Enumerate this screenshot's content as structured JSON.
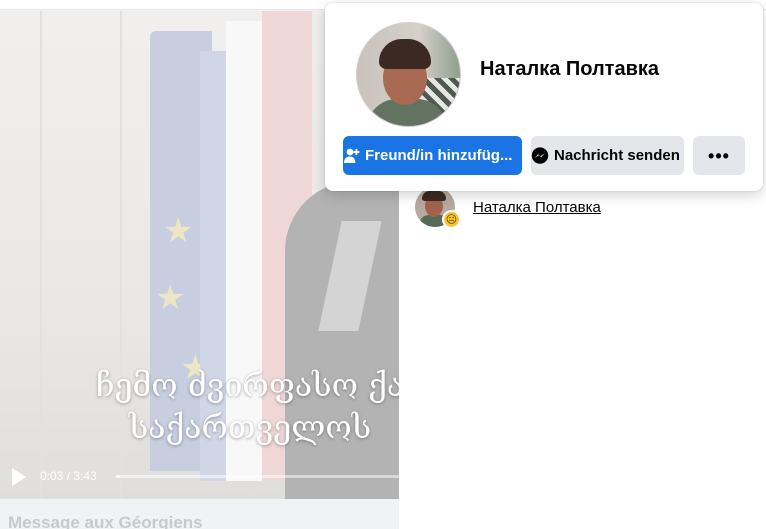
{
  "video": {
    "subtitle_line1": "ჩემო ძვირფასო ქა",
    "subtitle_line2": "საქართველოს",
    "current_time": "0:03",
    "separator": "/",
    "duration": "3:43",
    "progress_fraction": 0.013
  },
  "caption": {
    "title": "Message aux Géorgiens"
  },
  "profile_card": {
    "name": "Наталка Полтавка",
    "add_friend_label": "Freund/in hinzufüg...",
    "message_label": "Nachricht senden",
    "more_label": "•••",
    "primary_color": "#1b74e4"
  },
  "reactions_list": {
    "items": [
      {
        "name": "Наталка Полтавка",
        "reaction": "sad-reaction-emoji"
      }
    ]
  }
}
